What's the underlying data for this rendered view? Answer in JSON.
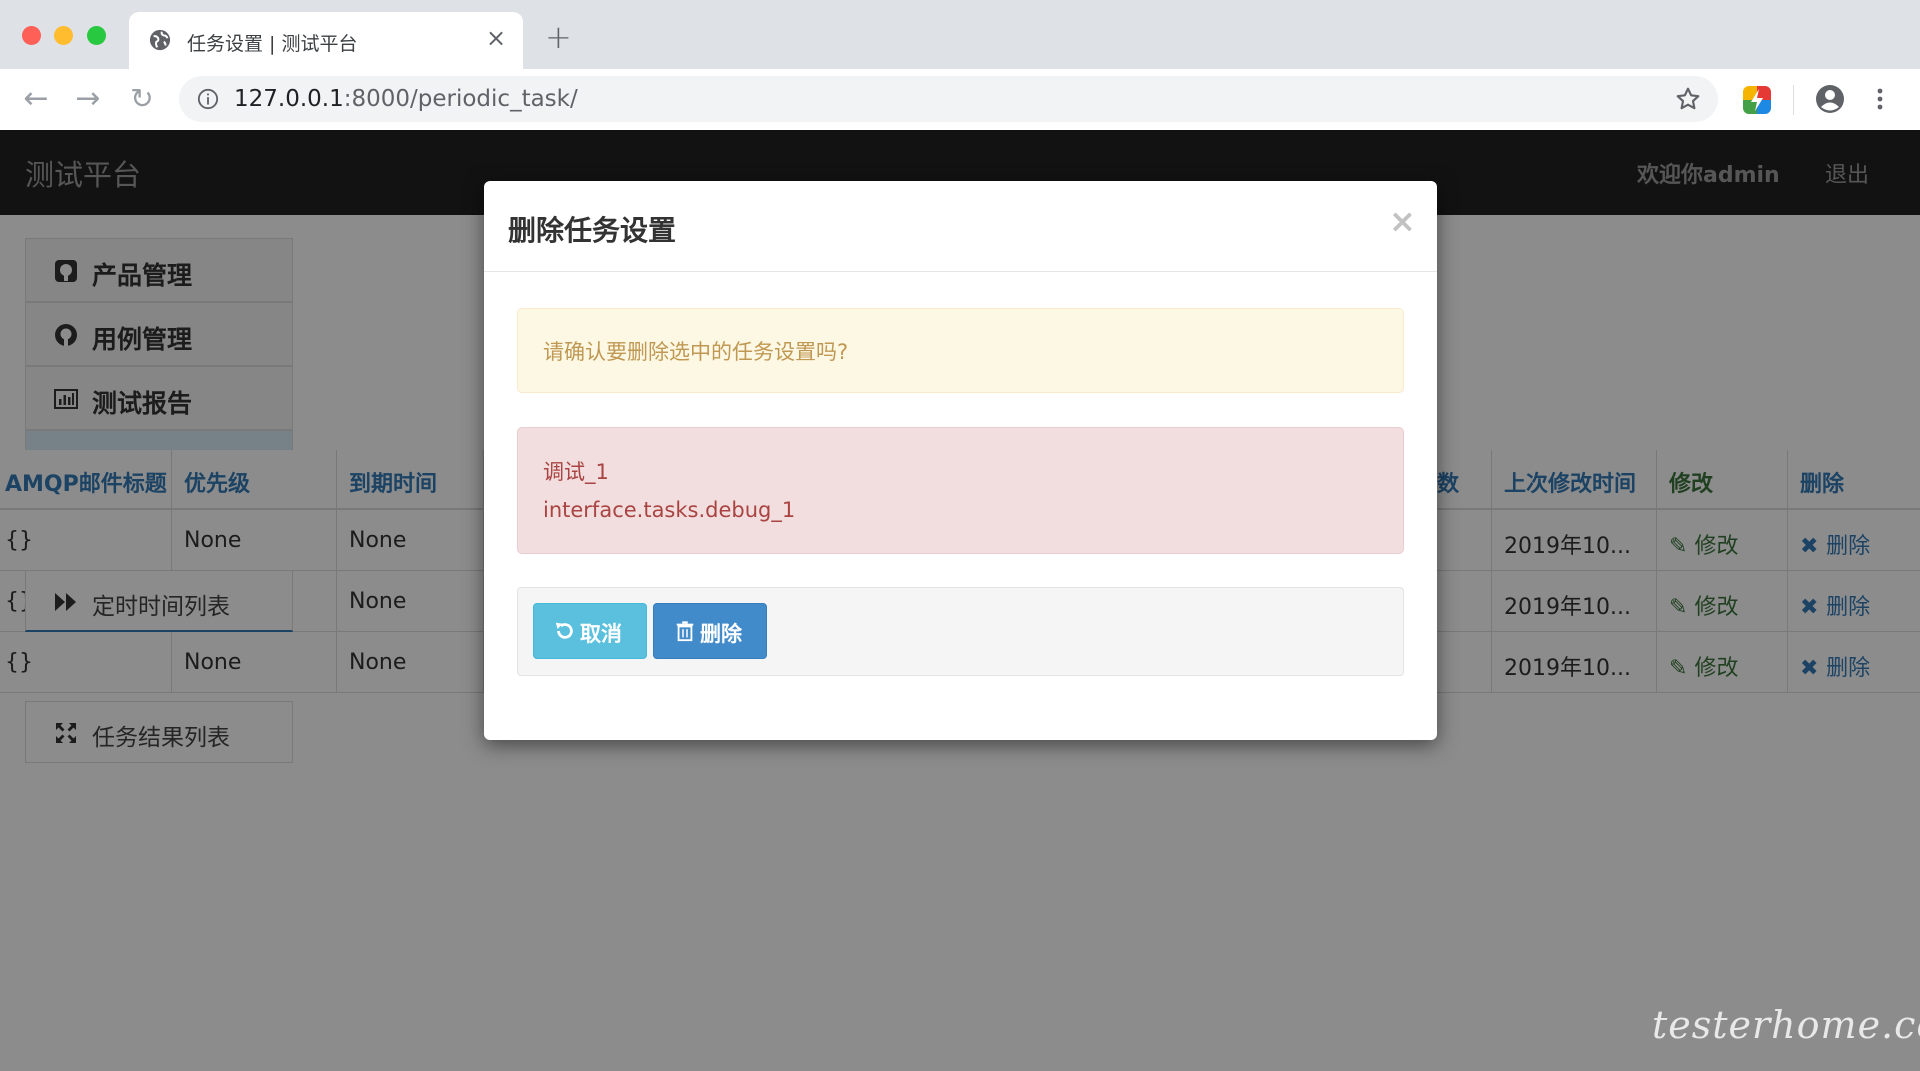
{
  "browser": {
    "tab_title": "任务设置 | 测试平台",
    "tab_close": "×",
    "new_tab": "+",
    "url_host": "127.0.0.1",
    "url_rest": ":8000/periodic_task/"
  },
  "navbar": {
    "brand": "测试平台",
    "welcome": "欢迎你admin",
    "logout": "退出"
  },
  "sidebar": {
    "items": [
      {
        "label": "产品管理",
        "icon": "github-square-icon"
      },
      {
        "label": "用例管理",
        "icon": "github-icon"
      },
      {
        "label": "测试报告",
        "icon": "bar-chart-icon"
      },
      {
        "label": "定时时间列表",
        "icon": "forward-icon"
      },
      {
        "label": "任务结果列表",
        "icon": "expand-icon"
      }
    ]
  },
  "table": {
    "headers": [
      "AMQP邮件标题",
      "优先级",
      "到期时间",
      "数",
      "上次修改时间",
      "修改",
      "删除"
    ],
    "rows": [
      [
        "{}",
        "None",
        "None",
        "2019年10...",
        "修改",
        "删除"
      ],
      [
        "{}",
        "None",
        "None",
        "2019年10...",
        "修改",
        "删除"
      ],
      [
        "{}",
        "None",
        "None",
        "2019年10...",
        "修改",
        "删除"
      ]
    ]
  },
  "modal": {
    "title": "删除任务设置",
    "close": "×",
    "confirm_text": "请确认要删除选中的任务设置吗?",
    "task_name": "调试_1",
    "task_path": "interface.tasks.debug_1",
    "cancel_label": "取消",
    "delete_label": "删除"
  },
  "watermark": "testerhome.com",
  "colors": {
    "navbar_bg": "#222222",
    "link": "#337ab7",
    "edit_green": "#3c763d",
    "warning_bg": "#fcf8e3",
    "danger_bg": "#f2dede",
    "cancel_btn": "#5bc0de",
    "delete_btn": "#428bca"
  }
}
